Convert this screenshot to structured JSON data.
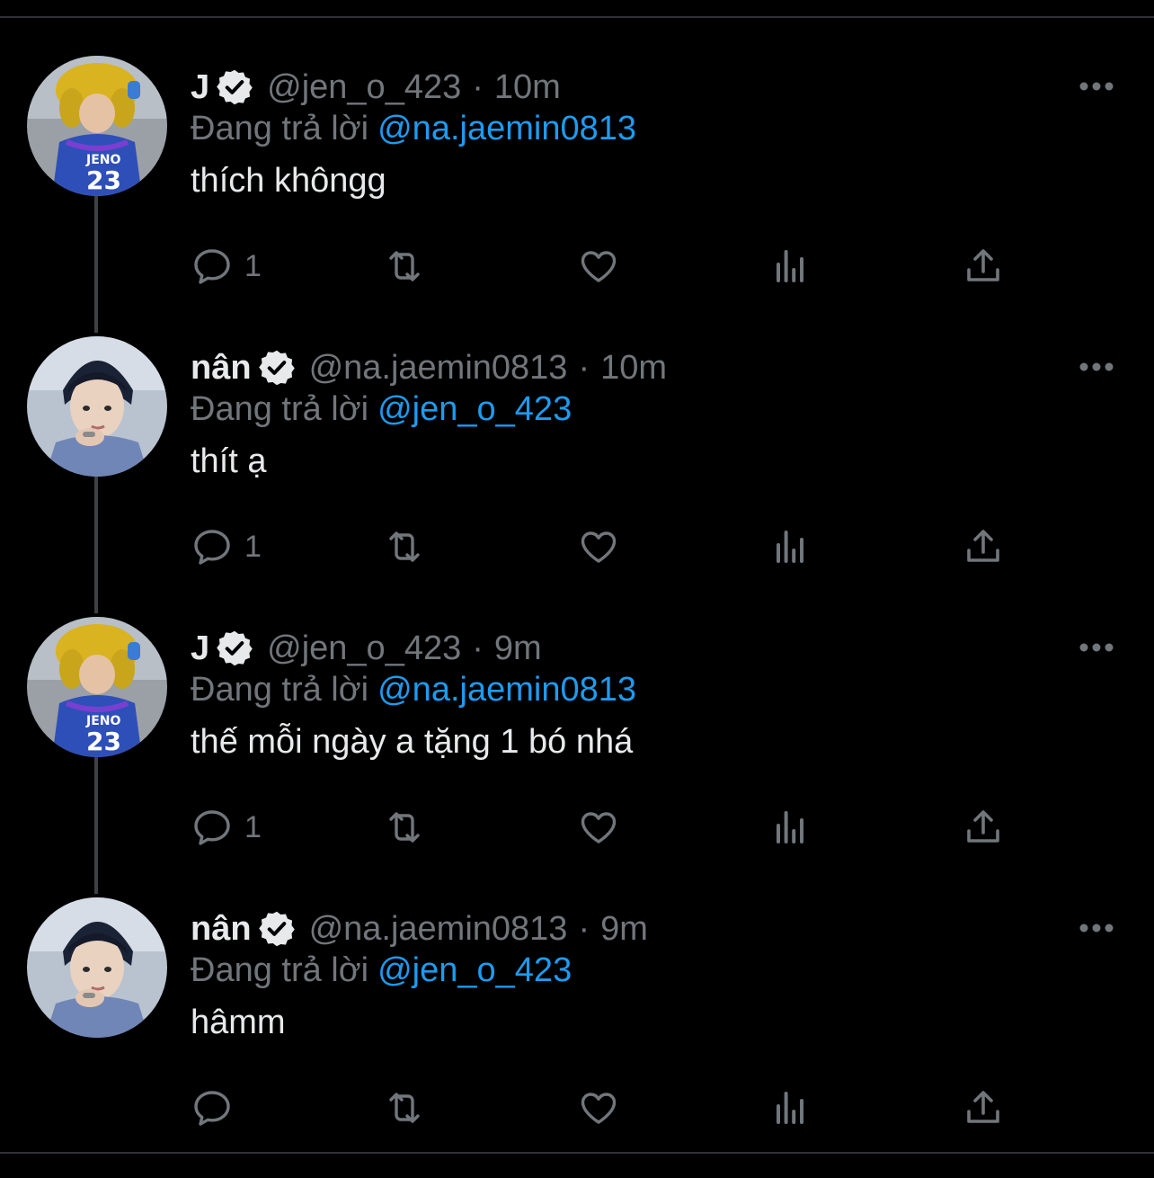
{
  "colors": {
    "background": "#000000",
    "primary_text": "#e7e9ea",
    "secondary_text": "#71767b",
    "accent": "#1d9bf0",
    "divider": "#2f3336"
  },
  "reply_prefix": "Đang trả lời",
  "tweets": [
    {
      "display_name": "J",
      "handle": "@jen_o_423",
      "dot": "·",
      "time": "10m",
      "reply_to": "@na.jaemin0813",
      "text": "thích khôngg",
      "reply_count": "1",
      "avatar": "avatar-jeno"
    },
    {
      "display_name": "nân",
      "handle": "@na.jaemin0813",
      "dot": "·",
      "time": "10m",
      "reply_to": "@jen_o_423",
      "text": "thít ạ",
      "reply_count": "1",
      "avatar": "avatar-jaemin"
    },
    {
      "display_name": "J",
      "handle": "@jen_o_423",
      "dot": "·",
      "time": "9m",
      "reply_to": "@na.jaemin0813",
      "text": "thế mỗi ngày a tặng 1 bó nhá",
      "reply_count": "1",
      "avatar": "avatar-jeno"
    },
    {
      "display_name": "nân",
      "handle": "@na.jaemin0813",
      "dot": "·",
      "time": "9m",
      "reply_to": "@jen_o_423",
      "text": "hâmm",
      "reply_count": "",
      "avatar": "avatar-jaemin"
    }
  ],
  "icons": {
    "reply": "reply-icon",
    "retweet": "retweet-icon",
    "like": "heart-icon",
    "views": "views-icon",
    "share": "share-icon",
    "more": "more-icon",
    "verified": "verified-badge-icon"
  }
}
